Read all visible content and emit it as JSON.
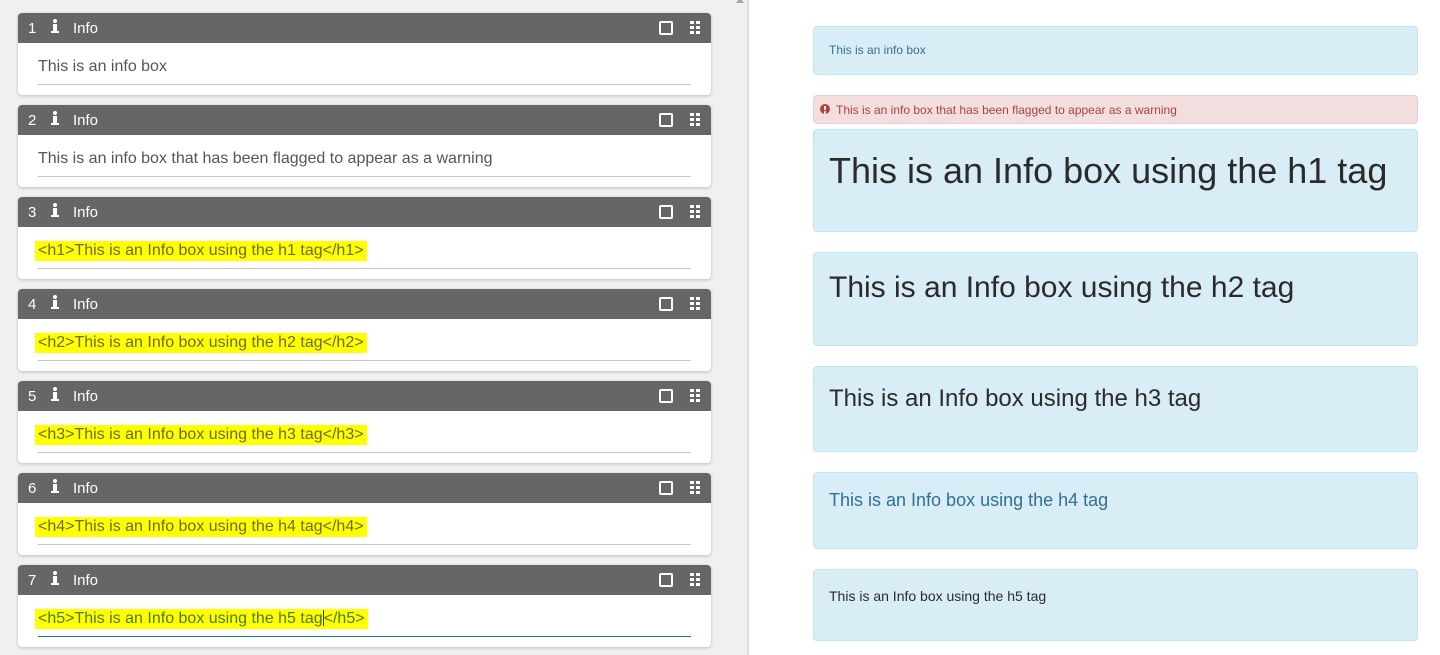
{
  "editor": {
    "blocks": [
      {
        "num": "1",
        "title": "Info",
        "text": "This is an info box",
        "highlighted": false
      },
      {
        "num": "2",
        "title": "Info",
        "text": "This is an info box that has been flagged to appear as a warning",
        "highlighted": false
      },
      {
        "num": "3",
        "title": "Info",
        "text": "<h1>This is an Info box using the h1 tag</h1>",
        "highlighted": true
      },
      {
        "num": "4",
        "title": "Info",
        "text": "<h2>This is an Info box using the h2 tag</h2>",
        "highlighted": true
      },
      {
        "num": "5",
        "title": "Info",
        "text": "<h3>This is an Info box using the h3 tag</h3>",
        "highlighted": true
      },
      {
        "num": "6",
        "title": "Info",
        "text": "<h4>This is an Info box using the h4 tag</h4>",
        "highlighted": true
      },
      {
        "num": "7",
        "title": "Info",
        "text_before_caret": "<h5>This is an Info box using the h5 tag",
        "text_after_caret": "</h5>",
        "highlighted": true
      }
    ],
    "icons": {
      "block_type": "info-icon",
      "select": "checkbox-icon",
      "drag": "drag-handle-icon"
    }
  },
  "preview": {
    "boxes": [
      {
        "text": "This is an info box",
        "style": "info"
      },
      {
        "text": "This is an info box that has been flagged to appear as a warning",
        "style": "warning",
        "icon": "exclamation-circle-icon"
      },
      {
        "text": "This is an Info box using the h1 tag",
        "style": "info-h1"
      },
      {
        "text": "This is an Info box using the h2 tag",
        "style": "info-h2"
      },
      {
        "text": "This is an Info box using the h3 tag",
        "style": "info-h3"
      },
      {
        "text": "This is an Info box using the h4 tag",
        "style": "info-h4"
      },
      {
        "text": "This is an Info box using the h5 tag",
        "style": "info-h5"
      }
    ]
  },
  "colors": {
    "block_header": "#666666",
    "highlight": "#ffff00",
    "info_bg": "#d9edf7",
    "info_border": "#bce8f1",
    "info_text": "#31708f",
    "warning_bg": "#f2dede",
    "warning_text": "#a94442",
    "active_underline": "#1e7d7d"
  }
}
